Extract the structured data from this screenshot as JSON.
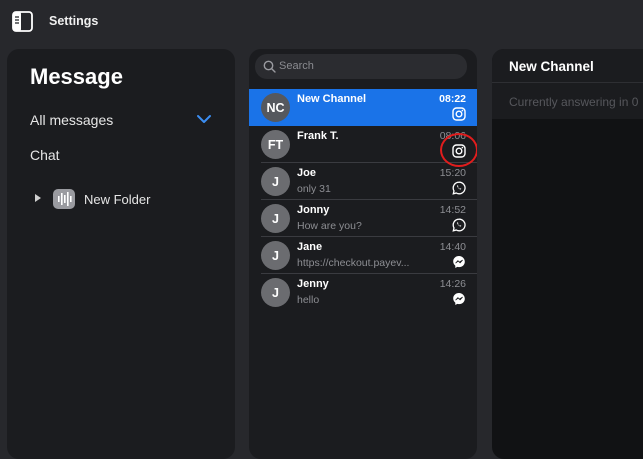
{
  "window": {
    "title": "Settings"
  },
  "sidebar": {
    "heading": "Message",
    "all_messages": "All messages",
    "chat": "Chat",
    "folders": [
      {
        "label": "New Folder"
      }
    ]
  },
  "search": {
    "placeholder": "Search",
    "value": ""
  },
  "conversations": [
    {
      "initials": "NC",
      "name": "New Channel",
      "preview": "",
      "time": "08:22",
      "channel": "instagram-icon",
      "active": true
    },
    {
      "initials": "FT",
      "name": "Frank T.",
      "preview": "",
      "time": "08:06",
      "channel": "instagram-icon",
      "active": false
    },
    {
      "initials": "J",
      "name": "Joe",
      "preview": "only 31",
      "time": "15:20",
      "channel": "whatsapp-icon",
      "active": false
    },
    {
      "initials": "J",
      "name": "Jonny",
      "preview": "How are you?",
      "time": "14:52",
      "channel": "whatsapp-icon",
      "active": false
    },
    {
      "initials": "J",
      "name": "Jane",
      "preview": "https://checkout.payev...",
      "time": "14:40",
      "channel": "messenger-icon",
      "active": false
    },
    {
      "initials": "J",
      "name": "Jenny",
      "preview": "hello",
      "time": "14:26",
      "channel": "messenger-icon",
      "active": false
    }
  ],
  "detail": {
    "title": "New Channel",
    "subtitle": "Currently answering in 0"
  },
  "colors": {
    "accent": "#1a73e8",
    "highlight_ring": "#e11d1d"
  }
}
